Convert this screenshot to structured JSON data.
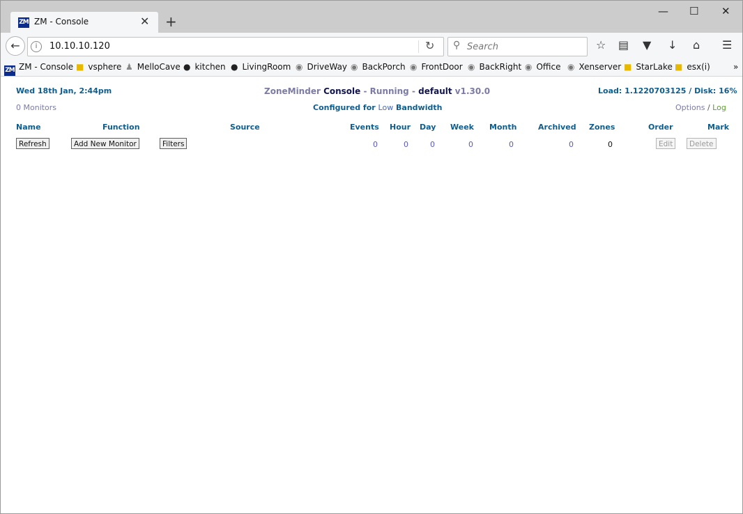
{
  "browser": {
    "tab_title": "ZM - Console",
    "tab_logo": "ZM",
    "tab_close": "✕",
    "new_tab": "+",
    "window_controls": [
      "—",
      "☐",
      "✕"
    ],
    "url": "10.10.10.120",
    "search_placeholder": "Search",
    "bookmarks": [
      {
        "label": "ZM - Console",
        "icon": "zm-logo"
      },
      {
        "label": "vsphere",
        "icon": "folder-icon"
      },
      {
        "label": "MelloCave",
        "icon": "person-icon"
      },
      {
        "label": "kitchen",
        "icon": "camera-icon"
      },
      {
        "label": "LivingRoom",
        "icon": "camera-icon"
      },
      {
        "label": "DriveWay",
        "icon": "globe-icon"
      },
      {
        "label": "BackPorch",
        "icon": "globe-icon"
      },
      {
        "label": "FrontDoor",
        "icon": "globe-icon"
      },
      {
        "label": "BackRight",
        "icon": "globe-icon"
      },
      {
        "label": "Office",
        "icon": "globe-icon"
      },
      {
        "label": "Xenserver",
        "icon": "globe-icon"
      },
      {
        "label": "StarLake",
        "icon": "folder-icon"
      },
      {
        "label": "esx(i)",
        "icon": "folder-icon"
      }
    ],
    "bookmarks_overflow": "»"
  },
  "header": {
    "datetime": "Wed 18th Jan, 2:44pm",
    "app_name": "ZoneMinder",
    "console": "Console",
    "sep1": "-",
    "state": "Running",
    "sep2": "-",
    "run_state": "default",
    "version": "v1.30.0",
    "load": "Load: 1.1220703125 / Disk: 16%",
    "monitors": "0 Monitors",
    "bandwidth_prefix": "Configured for",
    "bandwidth": "Low",
    "bandwidth_suffix": "Bandwidth",
    "options": "Options",
    "slash": "/",
    "log": "Log"
  },
  "table": {
    "columns": {
      "name": "Name",
      "function": "Function",
      "source": "Source",
      "events": "Events",
      "hour": "Hour",
      "day": "Day",
      "week": "Week",
      "month": "Month",
      "archived": "Archived",
      "zones": "Zones",
      "order": "Order",
      "mark": "Mark"
    },
    "buttons": {
      "refresh": "Refresh",
      "add": "Add New Monitor",
      "filters": "Filters",
      "edit": "Edit",
      "delete": "Delete"
    },
    "totals": {
      "events": "0",
      "hour": "0",
      "day": "0",
      "week": "0",
      "month": "0",
      "archived": "0",
      "zones": "0"
    }
  }
}
